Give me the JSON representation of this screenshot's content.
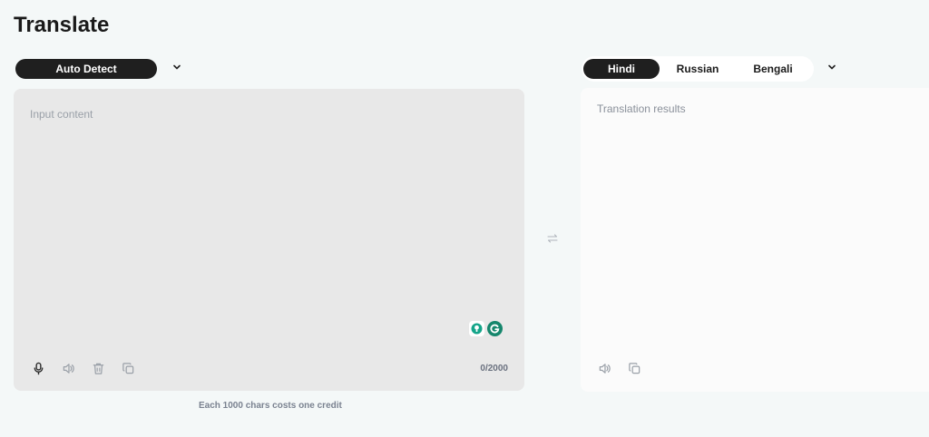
{
  "header": {
    "title": "Translate"
  },
  "source": {
    "language": "Auto Detect",
    "placeholder": "Input content",
    "char_count": "0/2000",
    "cost_note": "Each 1000 chars costs one credit"
  },
  "target": {
    "tabs": [
      {
        "label": "Hindi",
        "active": true
      },
      {
        "label": "Russian",
        "active": false
      },
      {
        "label": "Bengali",
        "active": false
      }
    ],
    "placeholder": "Translation results"
  },
  "icons": {
    "source_dropdown": "chevron-down-icon",
    "target_dropdown": "chevron-down-icon",
    "swap": "swap-arrows-icon",
    "mic": "microphone-icon",
    "speaker": "speaker-icon",
    "trash": "trash-icon",
    "copy": "copy-icon",
    "ext_bulb": "lightbulb-icon",
    "ext_grammarly": "grammarly-icon"
  },
  "colors": {
    "accent_dark": "#1f1f1f",
    "page_bg": "#f4f8f8",
    "input_bg": "#e8e8e8",
    "output_bg": "#fbfbfb",
    "grammarly_green": "#15866c"
  }
}
